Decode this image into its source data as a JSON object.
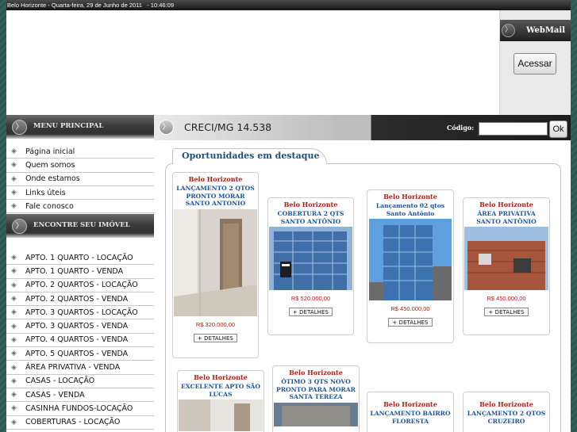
{
  "top_bar": {
    "text": "Belo Horizonte - Quarta-feira, 29 de Junho de 2011   - 10:46:09"
  },
  "webmail": {
    "title": "WebMail",
    "button": "Acessar"
  },
  "menu": {
    "header": "MENU PRINCIPAL",
    "items": [
      {
        "label": "Página inicial"
      },
      {
        "label": "Quem somos"
      },
      {
        "label": "Onde estamos"
      },
      {
        "label": "Links úteis"
      },
      {
        "label": "Fale conosco"
      }
    ]
  },
  "find": {
    "header": "ENCONTRE SEU IMÓVEL",
    "items": [
      {
        "label": "APTO. 1 QUARTO - LOCAÇÃO"
      },
      {
        "label": "APTO. 1 QUARTO - VENDA"
      },
      {
        "label": "APTO. 2 QUARTOS - LOCAÇÃO"
      },
      {
        "label": "APTO. 2 QUARTOS - VENDA"
      },
      {
        "label": "APTO. 3 QUARTOS - LOCAÇÃO"
      },
      {
        "label": "APTO. 3 QUARTOS - VENDA"
      },
      {
        "label": "APTO. 4 QUARTOS - VENDA"
      },
      {
        "label": "APTO. 5 QUARTOS - VENDA"
      },
      {
        "label": "ÁREA PRIVATIVA - VENDA"
      },
      {
        "label": "CASAS - LOCAÇÃO"
      },
      {
        "label": "CASAS - VENDA"
      },
      {
        "label": "CASINHA FUNDOS-LOCAÇÃO"
      },
      {
        "label": "COBERTURAS - LOCAÇÃO"
      }
    ]
  },
  "header": {
    "creci": "CRECI/MG 14.538",
    "codigo_label": "Código:",
    "codigo_value": "",
    "ok_button": "Ok"
  },
  "featured": {
    "title": "Oportunidades em destaque",
    "cards": [
      {
        "city": "Belo Horizonte",
        "title": "LANÇAMENTO 2 QTOS PRONTO MORAR SANTO ANTONIO",
        "price": "R$ 320.000,00",
        "button": "+ DETALHES",
        "photo": "interior"
      },
      {
        "city": "Belo Horizonte",
        "title": "COBERTURA 2 QTS SANTO ANTÔNIO",
        "price": "R$ 520.000,00",
        "button": "+ DETALHES",
        "photo": "building"
      },
      {
        "city": "Belo Horizonte",
        "title": "Lançamento 02 qtos Santo Antônio",
        "price": "R$ 450.000,00",
        "button": "+ DETALHES",
        "photo": "building-sky"
      },
      {
        "city": "Belo Horizonte",
        "title": "ÁREA PRIVATIVA SANTO ANTÔNIO",
        "price": "R$ 450.000,00",
        "button": "+ DETALHES",
        "photo": "brick"
      },
      {
        "city": "Belo Horizonte",
        "title": "EXCELENTE APTO SÃO LUCAS",
        "price": "",
        "button": "",
        "photo": "interior"
      },
      {
        "city": "Belo Horizonte",
        "title": "ÓTIMO 3 QTS NOVO PRONTO PARA MORAR SANTA TEREZA",
        "price": "",
        "button": "",
        "photo": "building"
      },
      {
        "city": "Belo Horizonte",
        "title": "LANÇAMENTO BAIRRO FLORESTA",
        "price": "",
        "button": "",
        "photo": ""
      },
      {
        "city": "Belo Horizonte",
        "title": "LANÇAMENTO 2 QTOS CRUZEIRO",
        "price": "",
        "button": "",
        "photo": ""
      }
    ]
  }
}
